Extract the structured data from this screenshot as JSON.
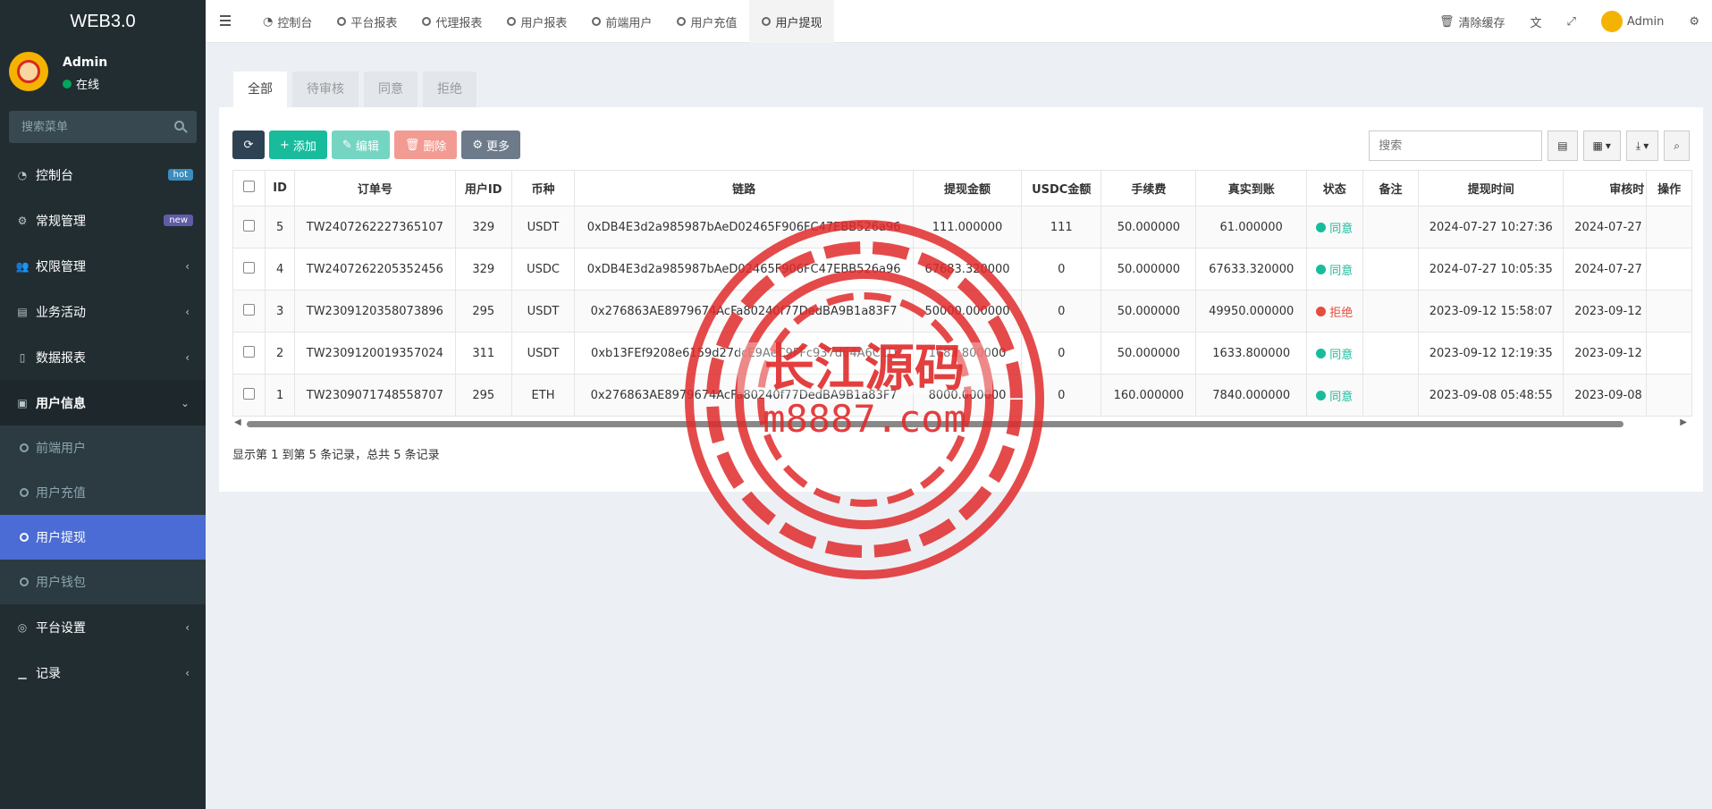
{
  "app": {
    "logo": "WEB3.0"
  },
  "user": {
    "name": "Admin",
    "status": "在线"
  },
  "sidebar": {
    "search_placeholder": "搜索菜单",
    "items": [
      {
        "label": "控制台",
        "icon": "dashboard-icon",
        "badge": "hot",
        "badge_color": "#3c8dbc"
      },
      {
        "label": "常规管理",
        "icon": "cogs-icon",
        "badge": "new",
        "badge_color": "#605ca8"
      },
      {
        "label": "权限管理",
        "icon": "users-icon"
      },
      {
        "label": "业务活动",
        "icon": "card-icon"
      },
      {
        "label": "数据报表",
        "icon": "file-icon"
      },
      {
        "label": "用户信息",
        "icon": "address-book-icon"
      },
      {
        "label": "平台设置",
        "icon": "settings-icon"
      },
      {
        "label": "记录",
        "icon": "chart-icon"
      }
    ],
    "sub_items": [
      "前端用户",
      "用户充值",
      "用户提现",
      "用户钱包"
    ],
    "active_sub": "用户提现"
  },
  "topnav": {
    "tabs": [
      "控制台",
      "平台报表",
      "代理报表",
      "用户报表",
      "前端用户",
      "用户充值",
      "用户提现"
    ],
    "active": "用户提现",
    "clear_cache": "清除缓存",
    "admin": "Admin"
  },
  "content": {
    "tabs": [
      "全部",
      "待审核",
      "同意",
      "拒绝"
    ],
    "toolbar": {
      "add": "添加",
      "edit": "编辑",
      "delete": "删除",
      "more": "更多"
    },
    "search_placeholder": "搜索",
    "columns": [
      "ID",
      "订单号",
      "用户ID",
      "币种",
      "链路",
      "提现金额",
      "USDC金额",
      "手续费",
      "真实到账",
      "状态",
      "备注",
      "提现时间",
      "审核时",
      "操作"
    ],
    "rows": [
      {
        "id": "5",
        "order": "TW2407262227365107",
        "uid": "329",
        "coin": "USDT",
        "chain": "0xDB4E3d2a985987bAeD02465F906FC47EBB526a96",
        "amount": "111.000000",
        "usdc": "111",
        "fee": "50.000000",
        "real": "61.000000",
        "status": "同意",
        "ok": true,
        "time": "2024-07-27 10:27:36",
        "audit": "2024-07-27"
      },
      {
        "id": "4",
        "order": "TW2407262205352456",
        "uid": "329",
        "coin": "USDC",
        "chain": "0xDB4E3d2a985987bAeD02465F906FC47EBB526a96",
        "amount": "67683.320000",
        "usdc": "0",
        "fee": "50.000000",
        "real": "67633.320000",
        "status": "同意",
        "ok": true,
        "time": "2024-07-27 10:05:35",
        "audit": "2024-07-27"
      },
      {
        "id": "3",
        "order": "TW2309120358073896",
        "uid": "295",
        "coin": "USDT",
        "chain": "0x276863AE8979674AcFa80240f77DedBA9B1a83F7",
        "amount": "50000.000000",
        "usdc": "0",
        "fee": "50.000000",
        "real": "49950.000000",
        "status": "拒绝",
        "ok": false,
        "time": "2023-09-12 15:58:07",
        "audit": "2023-09-12"
      },
      {
        "id": "2",
        "order": "TW2309120019357024",
        "uid": "311",
        "coin": "USDT",
        "chain": "0xb13FEf9208e6159d27dcE9AeC9FFc937d64A6C1D",
        "amount": "1683.800000",
        "usdc": "0",
        "fee": "50.000000",
        "real": "1633.800000",
        "status": "同意",
        "ok": true,
        "time": "2023-09-12 12:19:35",
        "audit": "2023-09-12"
      },
      {
        "id": "1",
        "order": "TW2309071748558707",
        "uid": "295",
        "coin": "ETH",
        "chain": "0x276863AE8979674AcFa80240f77DedBA9B1a83F7",
        "amount": "8000.000000",
        "usdc": "0",
        "fee": "160.000000",
        "real": "7840.000000",
        "status": "同意",
        "ok": true,
        "time": "2023-09-08 05:48:55",
        "audit": "2023-09-08"
      }
    ],
    "pager_info": "显示第 1 到第 5 条记录，总共 5 条记录"
  },
  "watermark": {
    "line1": "长江源码",
    "line2": "m8887.com"
  },
  "colors": {
    "sidebar": "#222d32",
    "accent": "#4a6cd4",
    "success": "#18bc9c",
    "danger": "#e74c3c",
    "stamp": "#e02a2a"
  }
}
